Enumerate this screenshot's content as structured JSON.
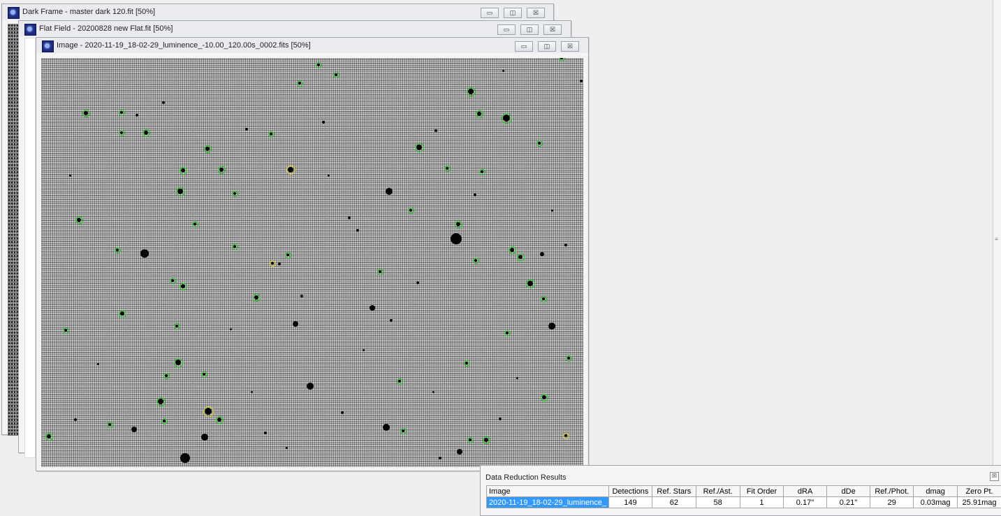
{
  "windows": {
    "dark": {
      "title": "Dark Frame - master dark 120.fit [50%]"
    },
    "flat": {
      "title": "Flat Field - 20200828 new Flat.fit [50%]"
    },
    "image": {
      "title": "Image - 2020-11-19_18-02-29_luminence_-10.00_120.00s_0002.fits [50%]"
    }
  },
  "window_buttons": {
    "minimize": "▭",
    "maximize": "◫",
    "close": "☒"
  },
  "results": {
    "title": "Data Reduction Results",
    "close_glyph": "☒",
    "columns": [
      "Image",
      "Detections",
      "Ref. Stars",
      "Ref./Ast.",
      "Fit Order",
      "dRA",
      "dDe",
      "Ref./Phot.",
      "dmag",
      "Zero Pt."
    ],
    "row": [
      "2020-11-19_18-02-29_luminence_",
      "149",
      "62",
      "58",
      "1",
      "0.17''",
      "0.21''",
      "29",
      "0.03mag",
      "25.91mag"
    ]
  },
  "colors": {
    "match_marker": "#22c822",
    "highlight_marker": "#e0d020",
    "selection": "#3399ff"
  }
}
